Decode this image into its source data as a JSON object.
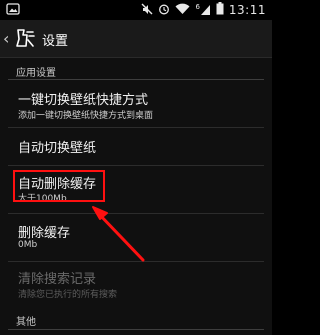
{
  "status_bar": {
    "time": "13:11",
    "signal_superscript": "6",
    "icons": [
      "notification-icon",
      "mute-icon",
      "alarm-icon",
      "wifi-icon",
      "signal-icon",
      "battery-icon"
    ]
  },
  "action_bar": {
    "title": "设置",
    "app_icon": "wallpaper-app-icon"
  },
  "sections": {
    "app_settings": "应用设置",
    "other": "其他"
  },
  "settings": [
    {
      "title": "一键切换壁纸快捷方式",
      "summary": "添加一键切换壁纸快捷方式到桌面",
      "enabled": true
    },
    {
      "title": "自动切换壁纸",
      "summary": "",
      "enabled": true
    },
    {
      "title": "自动删除缓存",
      "summary": "大于100Mb",
      "enabled": true
    },
    {
      "title": "删除缓存",
      "summary": "0Mb",
      "enabled": true
    },
    {
      "title": "清除搜索记录",
      "summary": "清除您已执行的所有搜索",
      "enabled": false
    }
  ],
  "annotation": {
    "highlight_color": "#ff1010"
  }
}
